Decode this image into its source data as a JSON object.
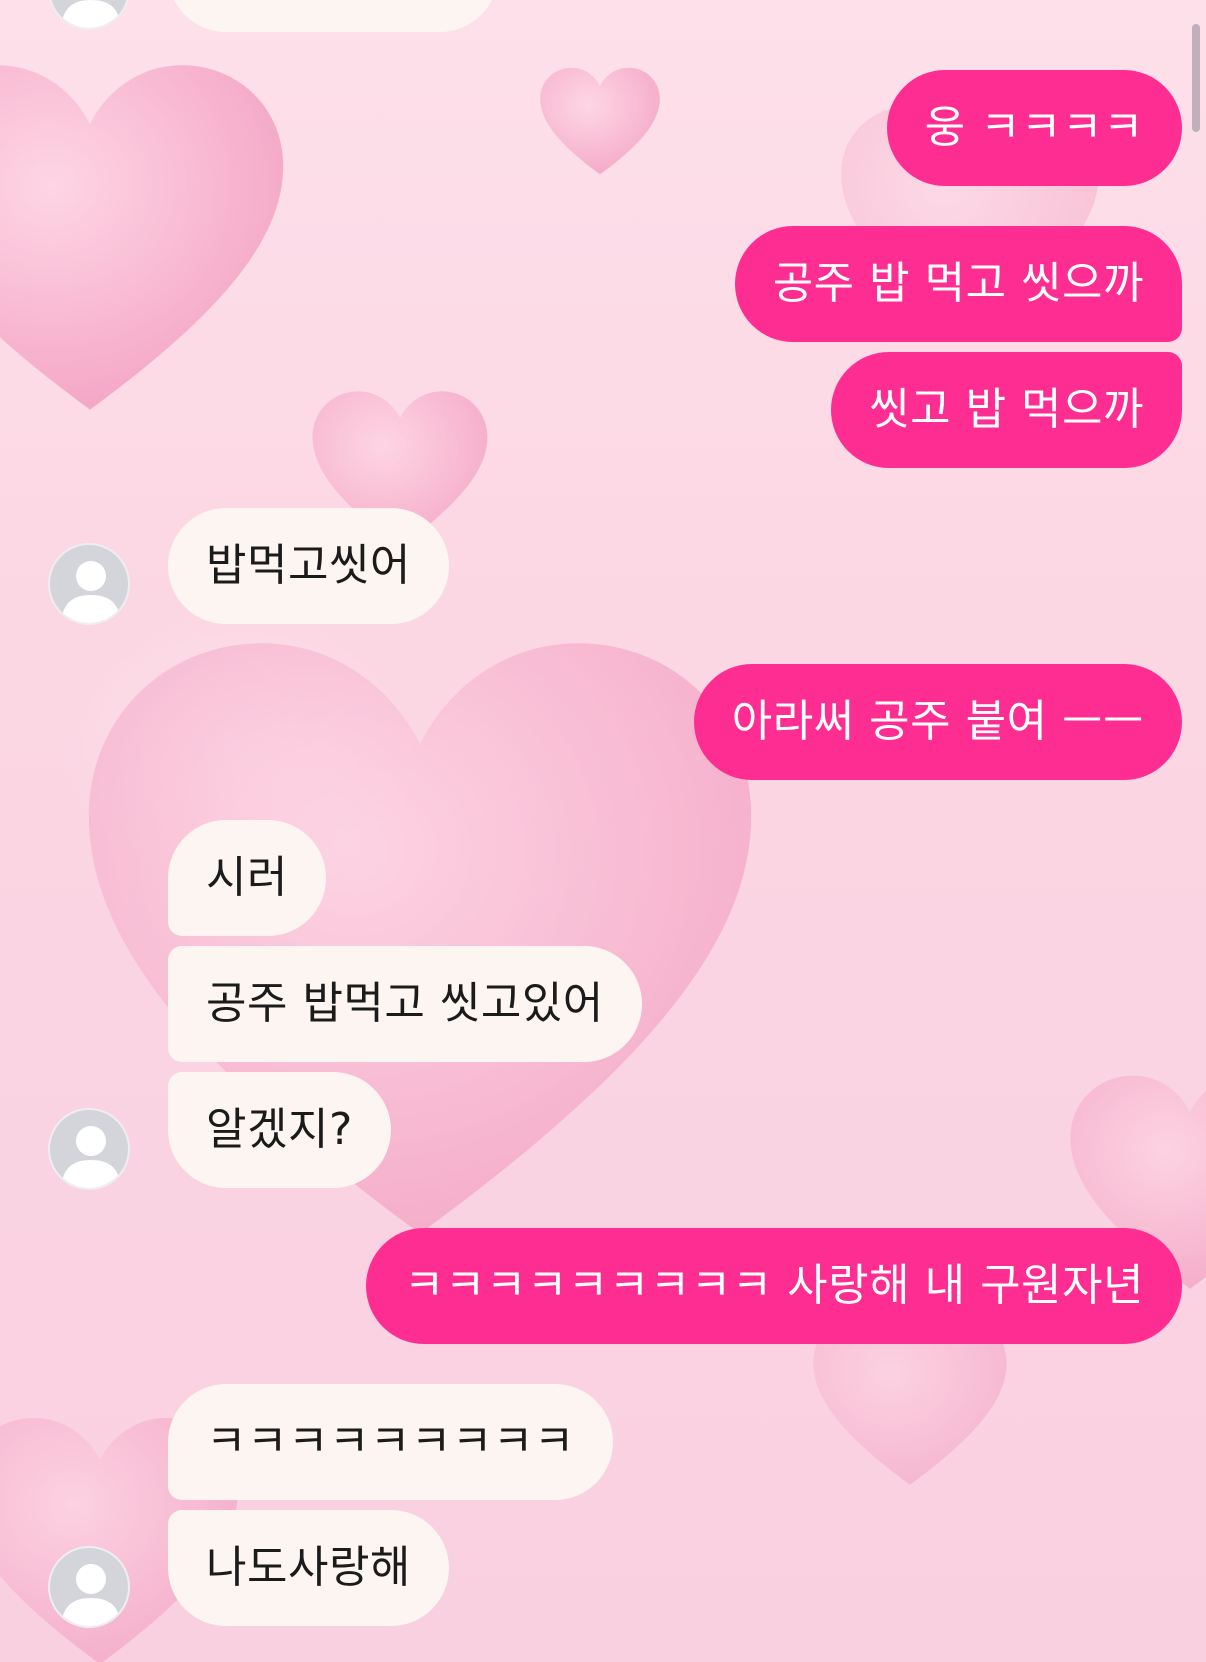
{
  "messages": [
    {
      "sender": "me",
      "text": "웅 ㅋㅋㅋㅋ"
    },
    {
      "sender": "me",
      "text": "공주 밥 먹고 씻으까"
    },
    {
      "sender": "me",
      "text": "씻고 밥 먹으까"
    },
    {
      "sender": "other",
      "text": "밥먹고씻어"
    },
    {
      "sender": "me",
      "text": "아라써 공주 붙여 ㅡㅡ"
    },
    {
      "sender": "other",
      "text": "시러"
    },
    {
      "sender": "other",
      "text": "공주 밥먹고 씻고있어"
    },
    {
      "sender": "other",
      "text": "알겠지?"
    },
    {
      "sender": "me",
      "text": "ㅋㅋㅋㅋㅋㅋㅋㅋㅋ 사랑해 내 구원자년"
    },
    {
      "sender": "other",
      "text": "ㅋㅋㅋㅋㅋㅋㅋㅋㅋ"
    },
    {
      "sender": "other",
      "text": "나도사랑해"
    }
  ],
  "colors": {
    "outgoing_bubble": "#fe2d91",
    "incoming_bubble": "#fdf5f2",
    "background": "#fbd9e6"
  },
  "icons": {
    "avatar": "default-profile-icon"
  }
}
